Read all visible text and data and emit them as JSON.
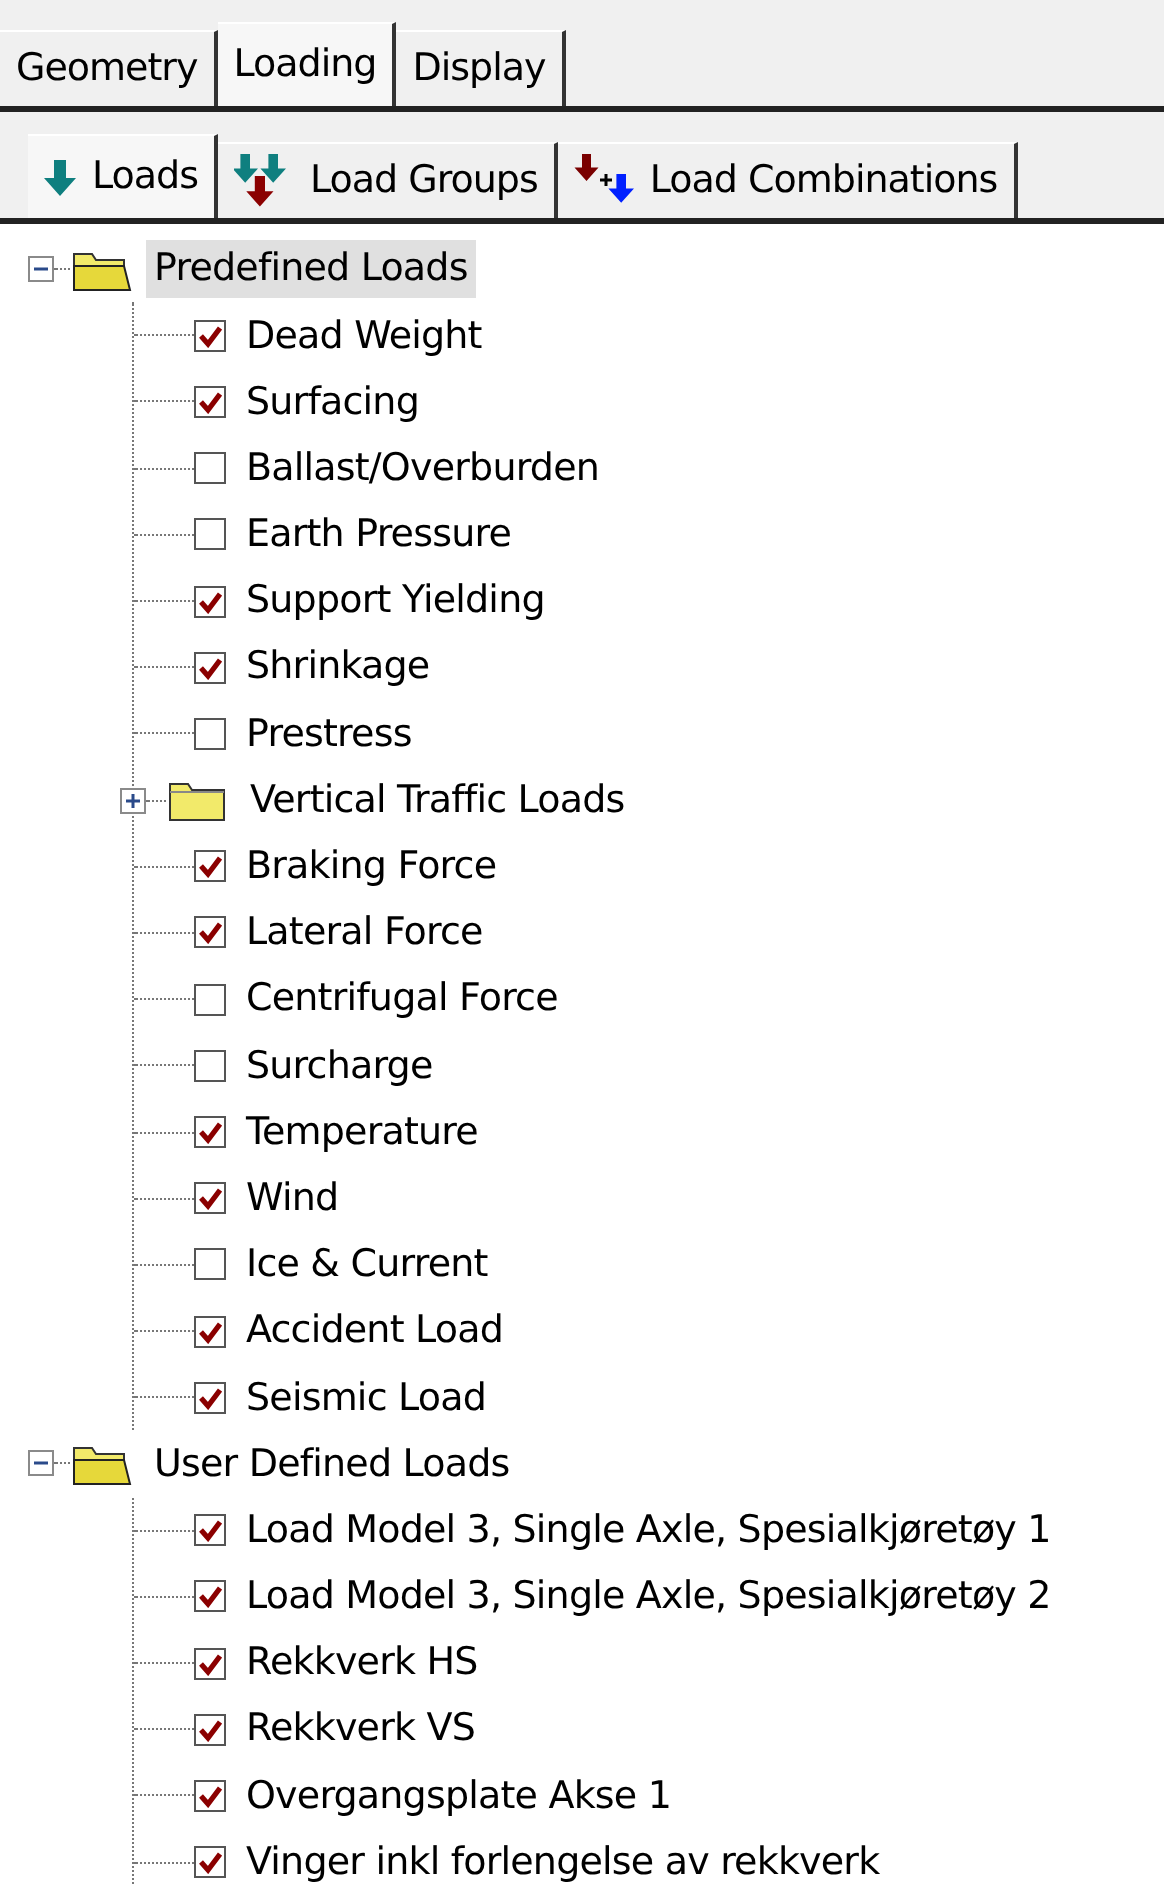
{
  "tabs": [
    {
      "label": "Geometry",
      "selected": false
    },
    {
      "label": "Loading",
      "selected": true
    },
    {
      "label": "Display",
      "selected": false
    }
  ],
  "subtabs": [
    {
      "label": "Loads",
      "selected": true
    },
    {
      "label": "Load Groups",
      "selected": false
    },
    {
      "label": "Load Combinations",
      "selected": false
    }
  ],
  "tree": [
    {
      "kind": "folder",
      "label": "Predefined Loads",
      "expanded": true,
      "selected": true,
      "children": [
        {
          "kind": "check",
          "label": "Dead Weight",
          "checked": true
        },
        {
          "kind": "check",
          "label": "Surfacing",
          "checked": true
        },
        {
          "kind": "check",
          "label": "Ballast/Overburden",
          "checked": false
        },
        {
          "kind": "check",
          "label": "Earth Pressure",
          "checked": false
        },
        {
          "kind": "check",
          "label": "Support Yielding",
          "checked": true
        },
        {
          "kind": "check",
          "label": "Shrinkage",
          "checked": true
        },
        {
          "kind": "check",
          "label": "Prestress",
          "checked": false
        },
        {
          "kind": "folder",
          "label": "Vertical Traffic Loads",
          "expanded": false,
          "selected": false
        },
        {
          "kind": "check",
          "label": "Braking Force",
          "checked": true
        },
        {
          "kind": "check",
          "label": "Lateral Force",
          "checked": true
        },
        {
          "kind": "check",
          "label": "Centrifugal Force",
          "checked": false
        },
        {
          "kind": "check",
          "label": "Surcharge",
          "checked": false
        },
        {
          "kind": "check",
          "label": "Temperature",
          "checked": true
        },
        {
          "kind": "check",
          "label": "Wind",
          "checked": true
        },
        {
          "kind": "check",
          "label": "Ice & Current",
          "checked": false
        },
        {
          "kind": "check",
          "label": "Accident Load",
          "checked": true
        },
        {
          "kind": "check",
          "label": "Seismic Load",
          "checked": true
        }
      ]
    },
    {
      "kind": "folder",
      "label": "User Defined Loads",
      "expanded": true,
      "selected": false,
      "children": [
        {
          "kind": "check",
          "label": "Load Model 3, Single Axle, Spesialkjøretøy 1",
          "checked": true
        },
        {
          "kind": "check",
          "label": "Load Model 3, Single Axle, Spesialkjøretøy 2",
          "checked": true
        },
        {
          "kind": "check",
          "label": "Rekkverk HS",
          "checked": true
        },
        {
          "kind": "check",
          "label": "Rekkverk VS",
          "checked": true
        },
        {
          "kind": "check",
          "label": "Overgangsplate Akse 1",
          "checked": true
        },
        {
          "kind": "check",
          "label": "Vinger inkl forlengelse av rekkverk",
          "checked": true
        }
      ]
    }
  ]
}
